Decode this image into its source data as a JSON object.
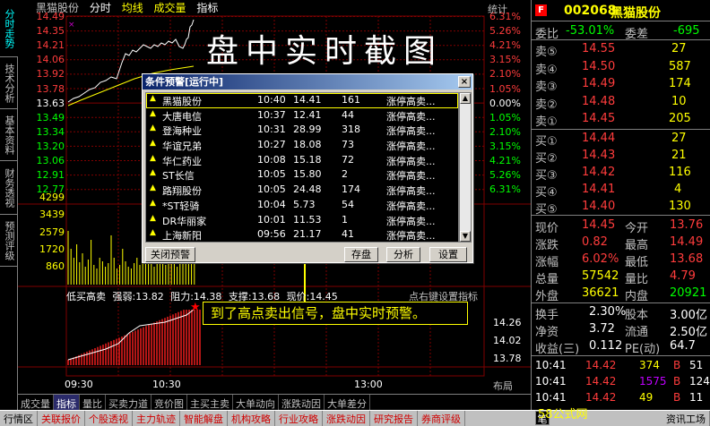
{
  "chart_header": {
    "stock_name": "黑猫股份",
    "tabs": [
      "分时",
      "均线",
      "成交量",
      "指标"
    ],
    "stats": "统计"
  },
  "watermark_title": "盘中实时截图",
  "left_tabs": [
    "分时走势",
    "技术分析",
    "基本资料",
    "财务透视",
    "预测评级"
  ],
  "price_axis_left": [
    "14.49",
    "14.35",
    "14.21",
    "14.06",
    "13.92",
    "13.78",
    "13.63",
    "13.49",
    "13.34",
    "13.20",
    "13.06",
    "12.91",
    "12.77"
  ],
  "price_axis_right": [
    "6.31%",
    "5.26%",
    "4.21%",
    "3.15%",
    "2.10%",
    "1.05%",
    "0.00%",
    "1.05%",
    "2.10%",
    "3.15%",
    "4.21%",
    "5.26%",
    "6.31%"
  ],
  "volume_axis": [
    "4299",
    "3439",
    "2579",
    "1720",
    "860"
  ],
  "indicator": {
    "label": "低买高卖",
    "strong_weak": "强弱:13.82",
    "resistance": "阻力:14.38",
    "support": "支撑:13.68",
    "current": "现价:14.45",
    "hint": "点右键设置指标",
    "axis": [
      "14.26",
      "14.02",
      "13.78"
    ]
  },
  "time_axis": [
    "09:30",
    "10:30",
    "13:00",
    "布局"
  ],
  "bottom_tabs": [
    "成交量",
    "指标",
    "量比",
    "买卖力道",
    "竞价图",
    "主买主卖",
    "大单动向",
    "涨跌动因",
    "大单差分"
  ],
  "status_tabs": [
    "行情区",
    "关联报价",
    "个股透视",
    "主力轨迹",
    "智能解盘",
    "机构攻略",
    "行业攻略",
    "涨跌动因",
    "研究报告",
    "券商评级"
  ],
  "status_right": [
    "资讯工场"
  ],
  "dialog": {
    "title": "条件预警[运行中]",
    "close": "×",
    "rows": [
      {
        "name": "黑猫股份",
        "time": "10:40",
        "price": "14.41",
        "vol": "161",
        "type": "涨停高卖..."
      },
      {
        "name": "大唐电信",
        "time": "10:37",
        "price": "12.41",
        "vol": "44",
        "type": "涨停高卖..."
      },
      {
        "name": "登海种业",
        "time": "10:31",
        "price": "28.99",
        "vol": "318",
        "type": "涨停高卖..."
      },
      {
        "name": "华谊兄弟",
        "time": "10:27",
        "price": "18.08",
        "vol": "73",
        "type": "涨停高卖..."
      },
      {
        "name": "华仁药业",
        "time": "10:08",
        "price": "15.18",
        "vol": "72",
        "type": "涨停高卖..."
      },
      {
        "name": "ST长信",
        "time": "10:05",
        "price": "15.80",
        "vol": "2",
        "type": "涨停高卖..."
      },
      {
        "name": "路翔股份",
        "time": "10:05",
        "price": "24.48",
        "vol": "174",
        "type": "涨停高卖..."
      },
      {
        "name": "*ST轻骑",
        "time": "10:04",
        "price": "5.73",
        "vol": "54",
        "type": "涨停高卖..."
      },
      {
        "name": "DR华丽家",
        "time": "10:01",
        "price": "11.53",
        "vol": "1",
        "type": "涨停高卖..."
      },
      {
        "name": "上海新阳",
        "time": "09:56",
        "price": "21.17",
        "vol": "41",
        "type": "涨停高卖..."
      }
    ],
    "buttons": {
      "close_alert": "关闭预警",
      "save": "存盘",
      "analyze": "分析",
      "settings": "设置"
    }
  },
  "callout": "到了高点卖出信号，盘中实时预警。",
  "quote": {
    "badge": "F",
    "code": "002068",
    "name": "黑猫股份",
    "wei_bi_label": "委比",
    "wei_bi": "-53.01%",
    "wei_cha_label": "委差",
    "wei_cha": "-695",
    "sells": [
      {
        "label": "卖⑤",
        "price": "14.55",
        "vol": "27"
      },
      {
        "label": "卖④",
        "price": "14.50",
        "vol": "587"
      },
      {
        "label": "卖③",
        "price": "14.49",
        "vol": "174"
      },
      {
        "label": "卖②",
        "price": "14.48",
        "vol": "10"
      },
      {
        "label": "卖①",
        "price": "14.45",
        "vol": "205"
      }
    ],
    "buys": [
      {
        "label": "买①",
        "price": "14.44",
        "vol": "27"
      },
      {
        "label": "买②",
        "price": "14.43",
        "vol": "21"
      },
      {
        "label": "买③",
        "price": "14.42",
        "vol": "116"
      },
      {
        "label": "买④",
        "price": "14.41",
        "vol": "4"
      },
      {
        "label": "买⑤",
        "price": "14.40",
        "vol": "130"
      }
    ],
    "stats": [
      {
        "l1": "现价",
        "v1": "14.45",
        "l2": "今开",
        "v2": "13.76"
      },
      {
        "l1": "涨跌",
        "v1": "0.82",
        "l2": "最高",
        "v2": "14.49"
      },
      {
        "l1": "涨幅",
        "v1": "6.02%",
        "l2": "最低",
        "v2": "13.68"
      },
      {
        "l1": "总量",
        "v1": "57542",
        "l2": "量比",
        "v2": "4.79"
      },
      {
        "l1": "外盘",
        "v1": "36621",
        "l2": "内盘",
        "v2": "20921"
      }
    ],
    "stats2": [
      {
        "l1": "换手",
        "v1": "2.30%",
        "l2": "股本",
        "v2": "3.00亿"
      },
      {
        "l1": "净资",
        "v1": "3.72",
        "l2": "流通",
        "v2": "2.50亿"
      },
      {
        "l1": "收益(三)",
        "v1": "0.112",
        "l2": "PE(动)",
        "v2": "64.7"
      }
    ],
    "trades": [
      {
        "time": "10:41",
        "price": "14.42",
        "vol": "374",
        "side": "B",
        "n": "51"
      },
      {
        "time": "10:41",
        "price": "14.42",
        "vol": "1575",
        "side": "B",
        "n": "124"
      },
      {
        "time": "10:41",
        "price": "14.42",
        "vol": "49",
        "side": "B",
        "n": "11"
      }
    ],
    "tab": "笔"
  },
  "site_logo": "58公式网",
  "site_url": "www.58gu.com"
}
